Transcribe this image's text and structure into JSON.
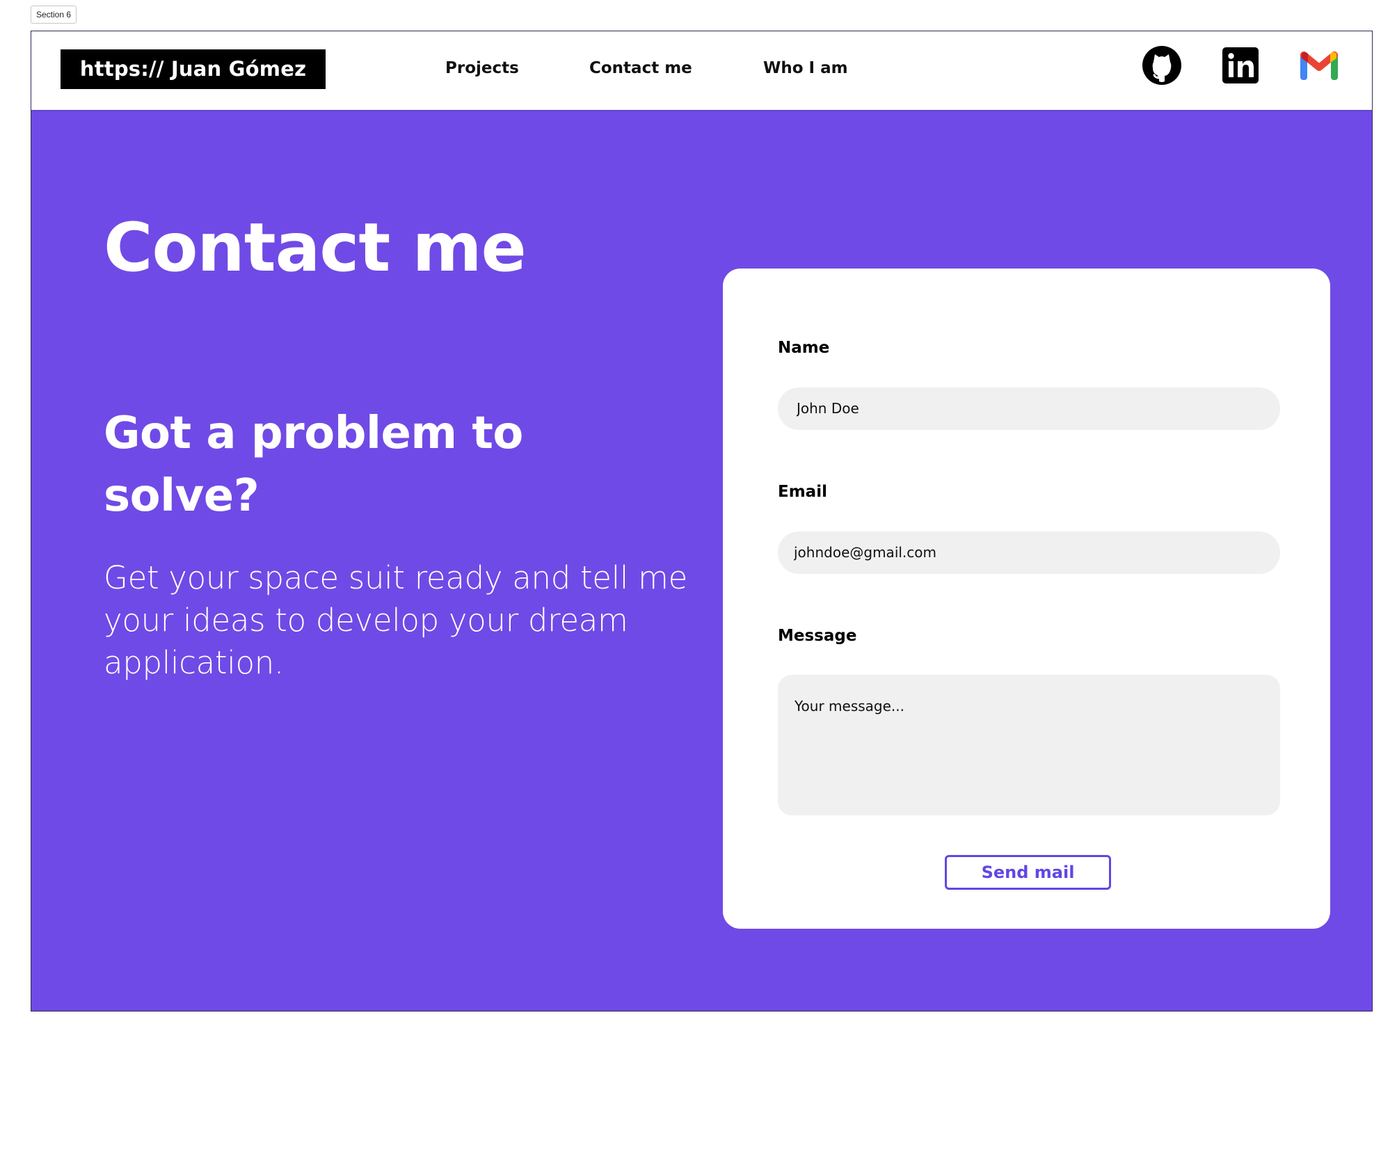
{
  "section_tag": "Section 6",
  "navbar": {
    "brand": "https:// Juan Gómez",
    "links": [
      {
        "label": "Projects"
      },
      {
        "label": "Contact me"
      },
      {
        "label": "Who I am"
      }
    ],
    "social_icons": [
      "github-icon",
      "linkedin-icon",
      "gmail-icon"
    ]
  },
  "hero": {
    "title": "Contact me",
    "subtitle": "Got a problem to solve?",
    "description": "Get your space suit ready and tell me your ideas to develop your dream application."
  },
  "form": {
    "name_label": "Name",
    "name_value": "John Doe",
    "email_label": "Email",
    "email_value": "johndoe@gmail.com",
    "message_label": "Message",
    "message_placeholder": "Your message...",
    "submit_label": "Send mail"
  },
  "colors": {
    "accent": "#704ae6",
    "button": "#6146e4",
    "input_background": "#f0f0f0",
    "brand_background": "#000000"
  }
}
